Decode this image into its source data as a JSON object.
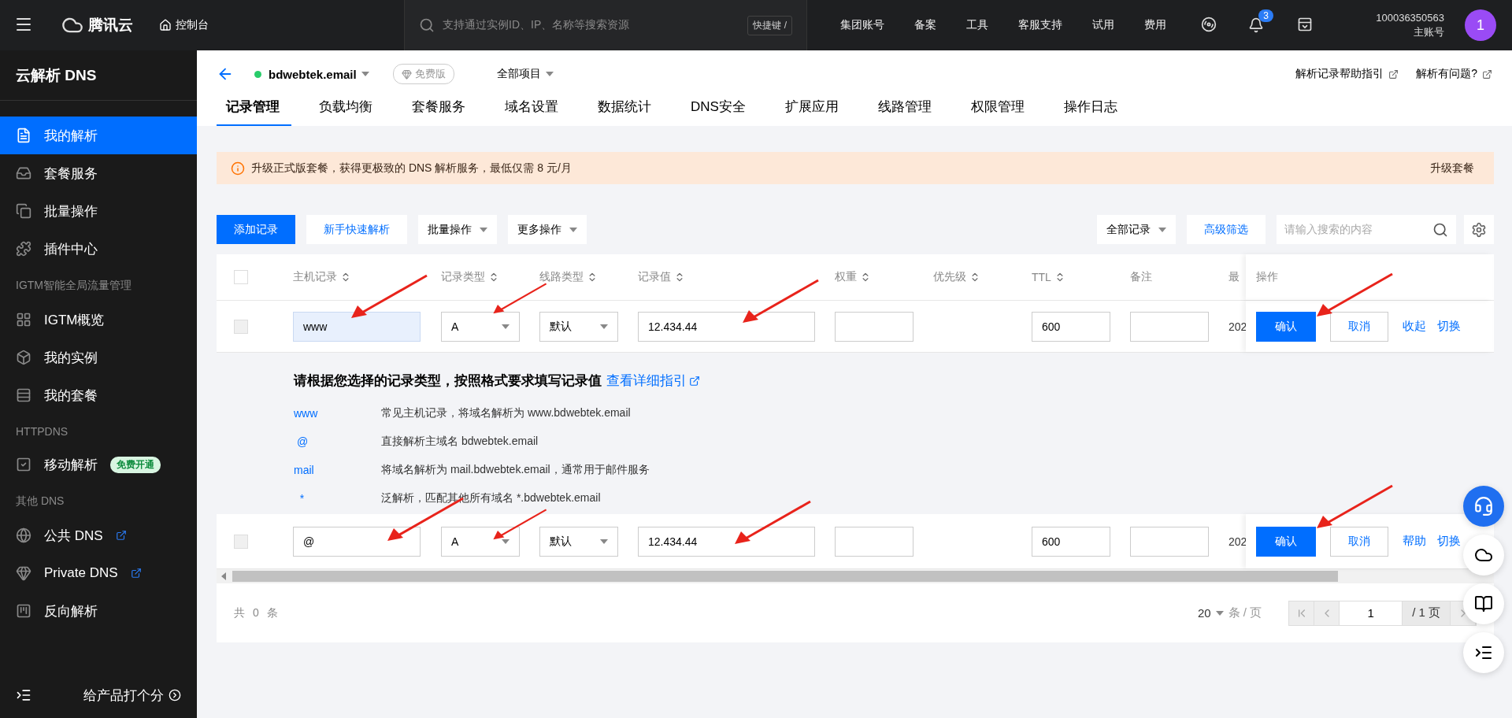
{
  "topbar": {
    "logo": "腾讯云",
    "console": "控制台",
    "search": {
      "placeholder": "支持通过实例ID、IP、名称等搜索资源",
      "shortcut": "快捷键 /"
    },
    "menu": [
      "集团账号",
      "备案",
      "工具",
      "客服支持",
      "试用",
      "费用"
    ],
    "notifications": "3",
    "account": {
      "id": "100036350563",
      "role": "主账号"
    },
    "avatar": "1"
  },
  "sidebar": {
    "title": "云解析 DNS",
    "sections": [
      {
        "items": [
          {
            "label": "我的解析",
            "selected": true
          },
          {
            "label": "套餐服务",
            "selected": false
          },
          {
            "label": "批量操作",
            "selected": false
          },
          {
            "label": "插件中心",
            "selected": false
          }
        ]
      },
      {
        "heading": "IGTM智能全局流量管理",
        "items": [
          {
            "label": "IGTM概览",
            "selected": false
          },
          {
            "label": "我的实例",
            "selected": false
          },
          {
            "label": "我的套餐",
            "selected": false
          }
        ]
      },
      {
        "heading": "HTTPDNS",
        "items": [
          {
            "label": "移动解析",
            "selected": false,
            "badge": "免费开通"
          }
        ]
      },
      {
        "heading": "其他 DNS",
        "items": [
          {
            "label": "公共 DNS",
            "selected": false,
            "external": true
          },
          {
            "label": "Private DNS",
            "selected": false,
            "external": true
          },
          {
            "label": "反向解析",
            "selected": false,
            "external": false
          }
        ]
      }
    ],
    "feedback": "给产品打个分"
  },
  "domain": {
    "name": "bdwebtek.email",
    "plan": "免费版",
    "project": "全部项目"
  },
  "help_links": [
    "解析记录帮助指引",
    "解析有问题?"
  ],
  "tabs": [
    {
      "label": "记录管理",
      "selected": true
    },
    {
      "label": "负载均衡",
      "selected": false
    },
    {
      "label": "套餐服务",
      "selected": false
    },
    {
      "label": "域名设置",
      "selected": false
    },
    {
      "label": "数据统计",
      "selected": false
    },
    {
      "label": "DNS安全",
      "selected": false
    },
    {
      "label": "扩展应用",
      "selected": false
    },
    {
      "label": "线路管理",
      "selected": false
    },
    {
      "label": "权限管理",
      "selected": false
    },
    {
      "label": "操作日志",
      "selected": false
    }
  ],
  "alert": {
    "text": "升级正式版套餐，获得更极致的 DNS 解析服务，最低仅需 8 元/月",
    "action": "升级套餐"
  },
  "toolbar": {
    "add": "添加记录",
    "quick": "新手快速解析",
    "batch": "批量操作",
    "more": "更多操作",
    "filter": "全部记录",
    "advanced": "高级筛选",
    "search_placeholder": "请输入搜索的内容"
  },
  "table": {
    "header_checked": false,
    "columns": [
      {
        "label": "主机记录",
        "sortable": true
      },
      {
        "label": "记录类型",
        "sortable": true
      },
      {
        "label": "线路类型",
        "sortable": true
      },
      {
        "label": "记录值",
        "sortable": true
      },
      {
        "label": "权重",
        "sortable": true
      },
      {
        "label": "优先级",
        "sortable": true
      },
      {
        "label": "TTL",
        "sortable": true
      },
      {
        "label": "备注",
        "sortable": false
      },
      {
        "label": "最",
        "sortable": false
      }
    ],
    "action_column": "操作",
    "rows": [
      {
        "checked": false,
        "disabled": true,
        "host": "www",
        "host_focused": true,
        "type": "A",
        "line": "默认",
        "value": "12.434.44",
        "ttl": "600",
        "last": "202",
        "confirm": "确认",
        "cancel": "取消",
        "links": [
          "收起",
          "切换"
        ],
        "arrows": true
      },
      {
        "checked": false,
        "disabled": true,
        "host": "@",
        "host_focused": false,
        "type": "A",
        "line": "默认",
        "value": "12.434.44",
        "ttl": "600",
        "last": "202",
        "confirm": "确认",
        "cancel": "取消",
        "links": [
          "帮助",
          "切换"
        ],
        "arrows": true
      }
    ],
    "guide": {
      "title": "请根据您选择的记录类型，按照格式要求填写记录值",
      "link": "查看详细指引",
      "items": [
        {
          "host": "www",
          "desc": "常见主机记录，将域名解析为 www.bdwebtek.email"
        },
        {
          "host": " @",
          "desc": "直接解析主域名 bdwebtek.email"
        },
        {
          "host": "mail",
          "desc": "将域名解析为 mail.bdwebtek.email，通常用于邮件服务"
        },
        {
          "host": "  *",
          "desc": "泛解析，匹配其他所有域名 *.bdwebtek.email"
        }
      ]
    }
  },
  "footer": {
    "total": "共 0 条",
    "page_size": "20",
    "per_page": "条 / 页",
    "page": "1",
    "pages": "/ 1 页"
  }
}
